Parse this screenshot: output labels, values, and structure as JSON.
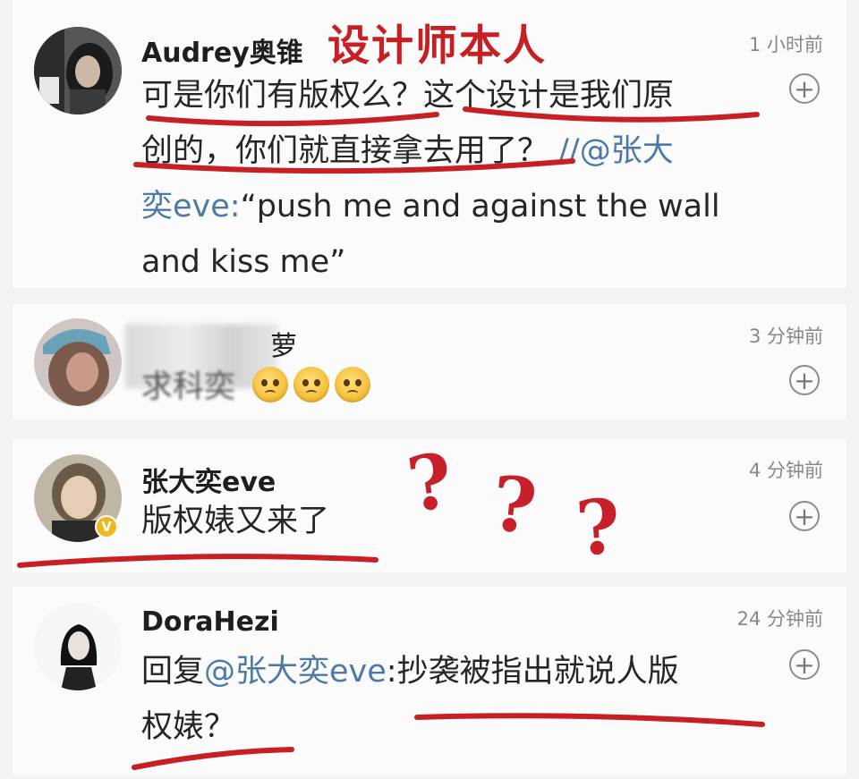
{
  "overlay": {
    "title": "设计师本人",
    "question_marks": [
      "?",
      "?",
      "?"
    ]
  },
  "comments": [
    {
      "username": "Audrey奥锥",
      "time": "1 小时前",
      "plus": "+",
      "text_lines": [
        "可是你们有版权么？这个设计是我们原",
        "创的，你们就直接拿去用了？",
        "奕eve:“push me and against the wall",
        "and kiss me”"
      ],
      "mention_inline": " //@张大",
      "mention_prefix": "奕eve:"
    },
    {
      "username": "萝",
      "time": "3 分钟前",
      "plus": "+",
      "text": "求科奕"
    },
    {
      "username": "张大奕eve",
      "time": "4 分钟前",
      "plus": "+",
      "badge": "V",
      "text": "版权婊又来了"
    },
    {
      "username": "DoraHezi",
      "time": "24 分钟前",
      "plus": "+",
      "reply_prefix": "回复",
      "mention": "@张大奕eve",
      "reply_rest": ":抄袭被指出就说人版",
      "reply_line2": "权婊？"
    }
  ],
  "colors": {
    "accent_red": "#c62024",
    "mention_blue": "#4c7aa6",
    "plus_icon": "#8c8c8c"
  }
}
